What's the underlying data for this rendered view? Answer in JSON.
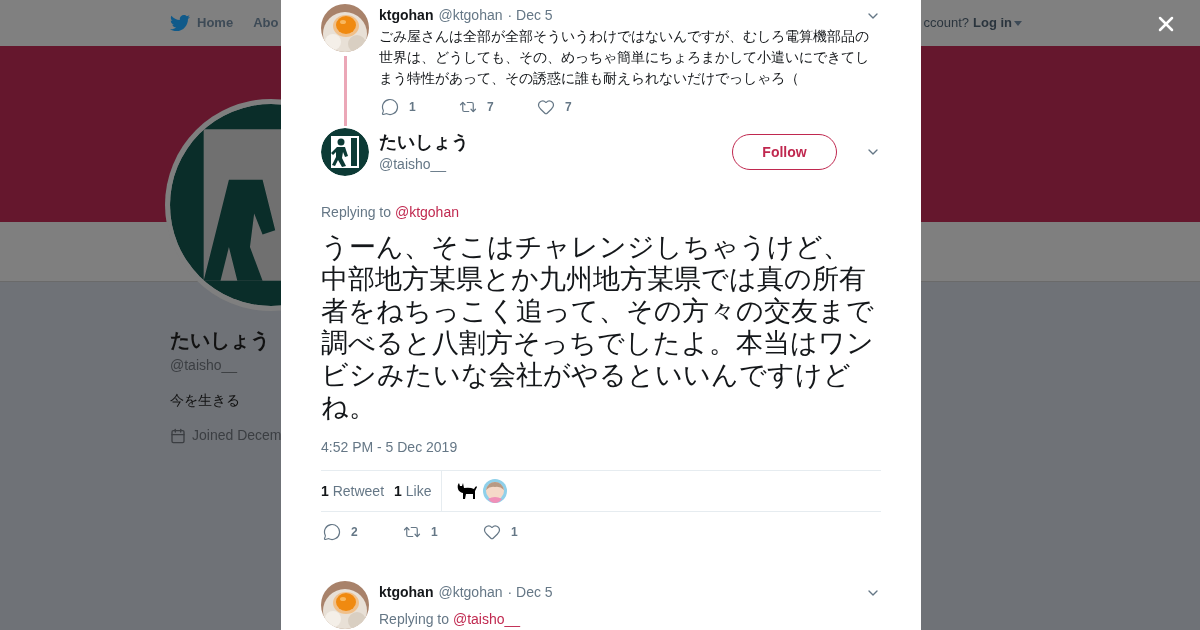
{
  "nav": {
    "items": [
      {
        "label": "Home",
        "kind": "bird"
      },
      {
        "label": "Abo",
        "kind": "text"
      }
    ],
    "account_prompt": "ccount?",
    "login": "Log in"
  },
  "profile": {
    "name": "たいしょう",
    "handle": "@taisho__",
    "bio": "今を生きる",
    "joined": "Joined Decem"
  },
  "parent_tweet": {
    "name": "ktgohan",
    "handle": "@ktgohan",
    "date": "· Dec 5",
    "text": "ごみ屋さんは全部が全部そういうわけではないんですが、むしろ電算機部品の世界は、どうしても、その、めっちゃ簡単にちょろまかして小遣いにできてしまう特性があって、その誘惑に誰も耐えられないだけでっしゃろ（",
    "replies": "1",
    "retweets": "7",
    "likes": "7"
  },
  "tweet": {
    "name": "たいしょう",
    "handle": "@taisho__",
    "follow": "Follow",
    "replying_prefix": "Replying to",
    "replying_to": "@ktgohan",
    "text_blocks": [
      "うーん、そこはチャレンジしちゃうけど、",
      "中部地方某県とか九州地方某県では真の所有者をねちっこく追って、その方々の交友まで調べると八割方そっちでしたよ。本当はワンビシみたいな会社がやるといいんですけどね。"
    ],
    "timestamp": "4:52 PM - 5 Dec 2019",
    "stats": [
      {
        "count": "1",
        "label": "Retweet"
      },
      {
        "count": "1",
        "label": "Like"
      }
    ],
    "likers": [
      {
        "kind": "cat"
      },
      {
        "kind": "avatar"
      }
    ],
    "replies": "2",
    "retweets": "1",
    "likes": "1"
  },
  "reply": {
    "name": "ktgohan",
    "handle": "@ktgohan",
    "date": "· Dec 5",
    "replying_prefix": "Replying to",
    "replying_to": "@taisho__"
  }
}
